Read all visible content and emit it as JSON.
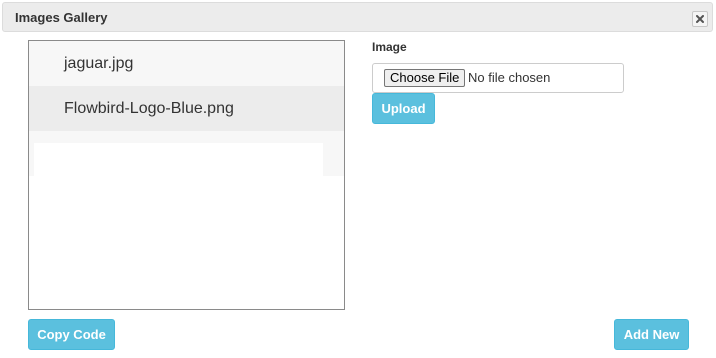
{
  "dialog": {
    "title": "Images Gallery",
    "close_icon": "close-icon"
  },
  "gallery": {
    "items": [
      {
        "label": "jaguar.jpg"
      },
      {
        "label": "Flowbird-Logo-Blue.png"
      }
    ]
  },
  "upload_form": {
    "label": "Image",
    "choose_file_label": "Choose File",
    "file_status": "No file chosen",
    "upload_label": "Upload"
  },
  "footer": {
    "copy_code_label": "Copy Code",
    "add_new_label": "Add New"
  },
  "colors": {
    "accent": "#5bc0de",
    "titlebar": "#ececec"
  }
}
